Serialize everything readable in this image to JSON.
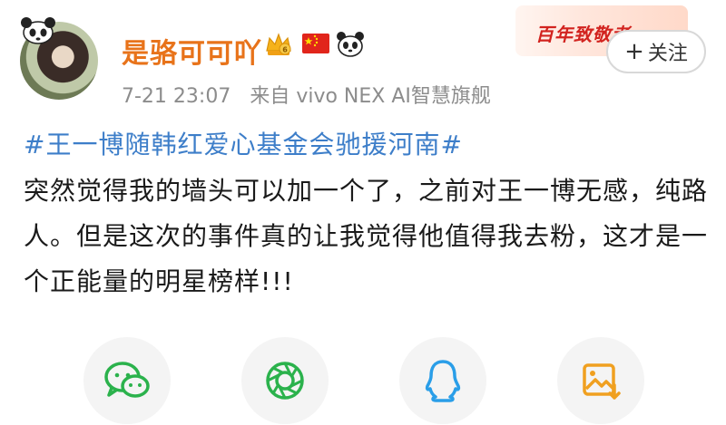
{
  "user": {
    "name": "是骆可可吖",
    "avatar_icon": "avatar-photo",
    "badges": [
      "vip-crown-icon",
      "china-flag-icon",
      "panda-icon"
    ]
  },
  "post": {
    "time": "7-21 23:07",
    "source": "来自 vivo NEX AI智慧旗舰",
    "hashtag": "#王一博随韩红爱心基金会驰援河南#",
    "text": "突然觉得我的墙头可以加一个了，之前对王一博无感，纯路人。但是这次的事件真的让我觉得他值得我去粉，这才是一个正能量的明星榜样!!!"
  },
  "header": {
    "decor_text": "百年致敬者",
    "follow_plus": "+",
    "follow_label": "关注"
  },
  "share": [
    {
      "name": "wechat-icon"
    },
    {
      "name": "moments-icon"
    },
    {
      "name": "qq-icon"
    },
    {
      "name": "save-image-icon"
    }
  ],
  "colors": {
    "username": "#e8731a",
    "hashtag": "#3d7ec9",
    "meta": "#8c8c8c",
    "wechat": "#2bb24c",
    "qq": "#2a9ee8",
    "save": "#f0a020"
  }
}
